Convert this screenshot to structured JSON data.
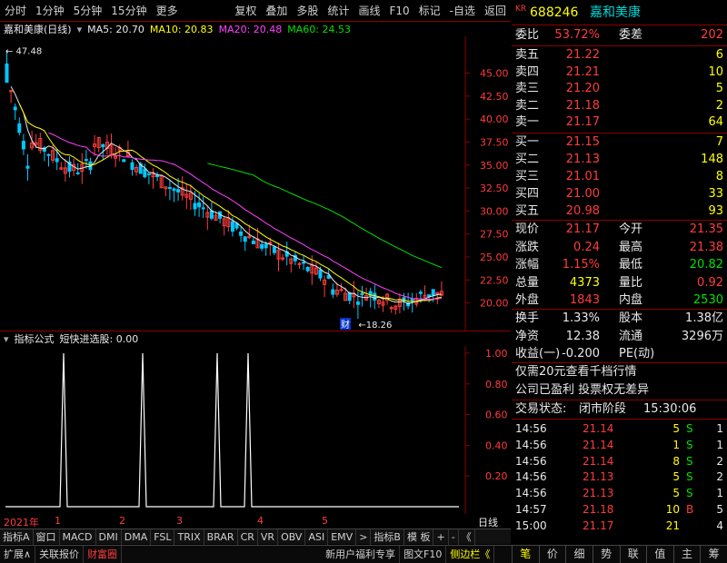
{
  "toolbar": {
    "left": [
      "分时",
      "1分钟",
      "5分钟",
      "15分钟",
      "更多"
    ],
    "right": [
      "复权",
      "叠加",
      "多股",
      "统计",
      "画线",
      "F10",
      "标记",
      "-自选",
      "返回"
    ]
  },
  "stock": {
    "code": "688246",
    "name": "嘉和美康",
    "prefix": "KR"
  },
  "chart_title": "嘉和美康(日线)",
  "ma": [
    {
      "label": "MA5: 20.70",
      "color": "#e8e8e8"
    },
    {
      "label": "MA10: 20.83",
      "color": "#ffff00"
    },
    {
      "label": "MA20: 20.48",
      "color": "#ff40ff"
    },
    {
      "label": "MA60: 24.53",
      "color": "#00e000"
    }
  ],
  "price_axis": [
    "45.00",
    "42.50",
    "40.00",
    "37.50",
    "35.00",
    "32.50",
    "30.00",
    "27.50",
    "25.00",
    "22.50",
    "20.00"
  ],
  "high_label": "47.48",
  "low_label": "18.26",
  "event_tag": "财",
  "indicator": {
    "title": "指标公式",
    "name": "短快进选股: 0.00",
    "axis": [
      "1.00",
      "0.80",
      "0.60",
      "0.40",
      "0.20"
    ]
  },
  "dates": {
    "year": "2021年",
    "months": [
      "1",
      "2",
      "3",
      "4",
      "5"
    ],
    "right": "日线"
  },
  "tabs": [
    "指标A",
    "窗口",
    "MACD",
    "DMI",
    "DMA",
    "FSL",
    "TRIX",
    "BRAR",
    "CR",
    "VR",
    "OBV",
    "ASI",
    "EMV",
    ">",
    "指标B",
    "模 板",
    "+",
    "-",
    "《"
  ],
  "status": [
    "扩展∧",
    "关联报价",
    "财富圈",
    "新用户福利专享",
    "图文F10",
    "侧边栏《"
  ],
  "order_book": {
    "weibi": {
      "label": "委比",
      "value": "53.72%",
      "label2": "委差",
      "value2": "202"
    },
    "sells": [
      {
        "label": "卖五",
        "price": "21.22",
        "vol": "6"
      },
      {
        "label": "卖四",
        "price": "21.21",
        "vol": "10"
      },
      {
        "label": "卖三",
        "price": "21.20",
        "vol": "5"
      },
      {
        "label": "卖二",
        "price": "21.18",
        "vol": "2"
      },
      {
        "label": "卖一",
        "price": "21.17",
        "vol": "64"
      }
    ],
    "buys": [
      {
        "label": "买一",
        "price": "21.15",
        "vol": "7"
      },
      {
        "label": "买二",
        "price": "21.13",
        "vol": "148"
      },
      {
        "label": "买三",
        "price": "21.01",
        "vol": "8"
      },
      {
        "label": "买四",
        "price": "21.00",
        "vol": "33"
      },
      {
        "label": "买五",
        "price": "20.98",
        "vol": "93"
      }
    ]
  },
  "quote": [
    {
      "l1": "现价",
      "v1": "21.17",
      "l2": "今开",
      "v2": "21.35"
    },
    {
      "l1": "涨跌",
      "v1": "0.24",
      "l2": "最高",
      "v2": "21.38"
    },
    {
      "l1": "涨幅",
      "v1": "1.15%",
      "l2": "最低",
      "v2": "20.82"
    },
    {
      "l1": "总量",
      "v1": "4373",
      "l2": "量比",
      "v2": "0.92"
    },
    {
      "l1": "外盘",
      "v1": "1843",
      "l2": "内盘",
      "v2": "2530"
    }
  ],
  "fund": [
    {
      "l1": "换手",
      "v1": "1.33%",
      "l2": "股本",
      "v2": "1.38亿"
    },
    {
      "l1": "净资",
      "v1": "12.38",
      "l2": "流通",
      "v2": "3296万"
    },
    {
      "l1": "收益(一)",
      "v1": "-0.200",
      "l2": "PE(动)",
      "v2": ""
    }
  ],
  "notices": [
    "仅需20元查看千档行情",
    "公司已盈利 投票权无差异"
  ],
  "trade_status": {
    "label": "交易状态:",
    "value": "闭市阶段",
    "time": "15:30:06"
  },
  "ticks": [
    {
      "t": "14:56",
      "p": "21.14",
      "v": "5",
      "s": "S",
      "n": "1"
    },
    {
      "t": "14:56",
      "p": "21.14",
      "v": "1",
      "s": "S",
      "n": "1"
    },
    {
      "t": "14:56",
      "p": "21.14",
      "v": "8",
      "s": "S",
      "n": "2"
    },
    {
      "t": "14:56",
      "p": "21.13",
      "v": "5",
      "s": "S",
      "n": "2"
    },
    {
      "t": "14:56",
      "p": "21.13",
      "v": "5",
      "s": "S",
      "n": "1"
    },
    {
      "t": "14:57",
      "p": "21.18",
      "v": "10",
      "s": "B",
      "n": "5"
    },
    {
      "t": "15:00",
      "p": "21.17",
      "v": "21",
      "s": "",
      "n": "4"
    }
  ],
  "bottom_tabs": [
    "笔",
    "价",
    "细",
    "势",
    "联",
    "值",
    "主",
    "筹"
  ]
}
